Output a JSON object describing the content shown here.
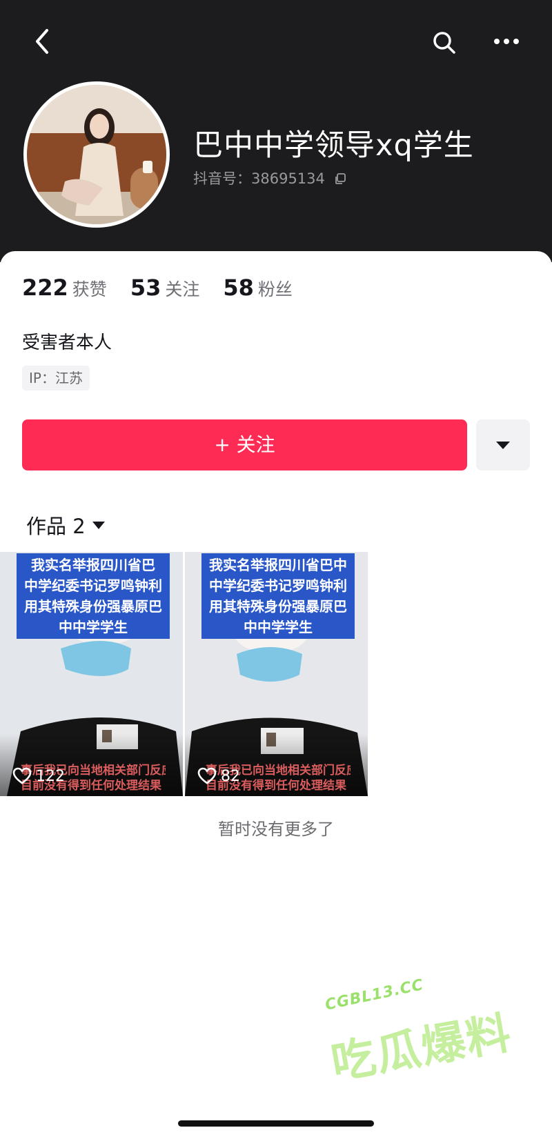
{
  "header": {
    "back_icon": "chevron-left-icon",
    "search_icon": "search-icon",
    "more_icon": "more-dots-icon",
    "nickname": "巴中中学领导xq学生",
    "douyin_id": "抖音号：38695134",
    "background_color": "#1c1b1d"
  },
  "stats": [
    {
      "value": "222",
      "label": "获赞"
    },
    {
      "value": "53",
      "label": "关注"
    },
    {
      "value": "58",
      "label": "粉丝"
    }
  ],
  "bio": "受害者本人",
  "ip_location": "IP：江苏",
  "actions": {
    "follow_label": "+ 关注",
    "follow_color": "#fe2c55"
  },
  "works_tab": {
    "label": "作品 2"
  },
  "videos": [
    {
      "caption": [
        "我实名举报四川省巴",
        "中学纪委书记罗鸣钟利",
        "用其特殊身份强暴原巴",
        "中中学学生"
      ],
      "bottom_text": [
        "事后我已向当地相关部门反应",
        "目前没有得到任何处理结果 期"
      ],
      "likes": "122"
    },
    {
      "caption": [
        "我实名举报四川省巴中",
        "中学纪委书记罗鸣钟利",
        "用其特殊身份强暴原巴",
        "中中学学生"
      ],
      "bottom_text": [
        "事后我已向当地相关部门反应",
        "目前没有得到任何处理结果 期"
      ],
      "likes": "82"
    }
  ],
  "end_text": "暂时没有更多了",
  "watermark": {
    "url": "CGBL13.CC",
    "text": "吃瓜爆料"
  }
}
